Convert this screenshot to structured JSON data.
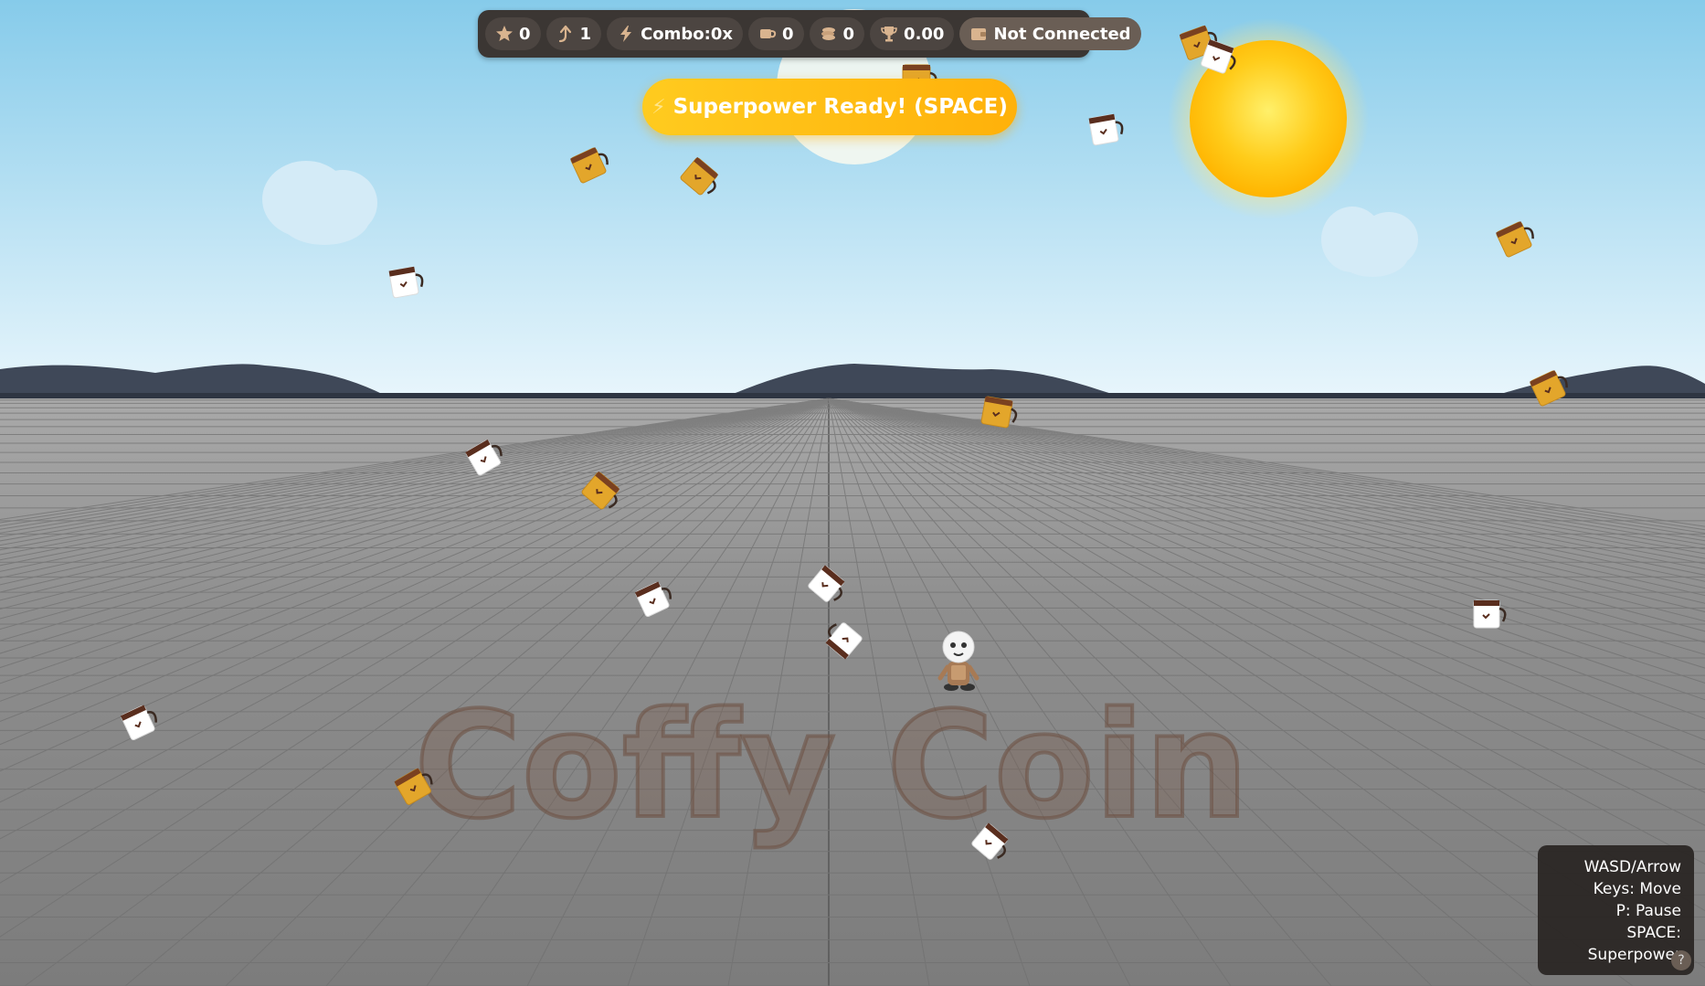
{
  "hud": {
    "stars": "0",
    "level": "1",
    "combo": "Combo:0x",
    "cups": "0",
    "coins": "0",
    "trophy": "0.00",
    "connection": "Not Connected"
  },
  "banner": {
    "text": "Superpower Ready! (SPACE)"
  },
  "watermark": "Coffy Coin",
  "help": {
    "line1": "WASD/Arrow",
    "line2": "Keys: Move",
    "line3": "P: Pause",
    "line4": "SPACE:",
    "line5": "Superpower",
    "button": "?"
  },
  "colors": {
    "sky_top": "#87ceeb",
    "sky_bottom": "#e6f4fb",
    "ground": "#8a8a8a",
    "mountain": "#3e4757",
    "sun": "#ffc40f",
    "gold_mug": "#e2a52b",
    "white_mug": "#ffffff",
    "coffee": "#5a2e1e",
    "watermark": "#7a5f50",
    "hud_bg": "#3b3633",
    "banner": "#ffbe15"
  },
  "icons": [
    "star-icon",
    "arrow-up-icon",
    "bolt-icon",
    "cup-icon",
    "coins-icon",
    "trophy-icon",
    "wallet-icon",
    "help-icon"
  ]
}
